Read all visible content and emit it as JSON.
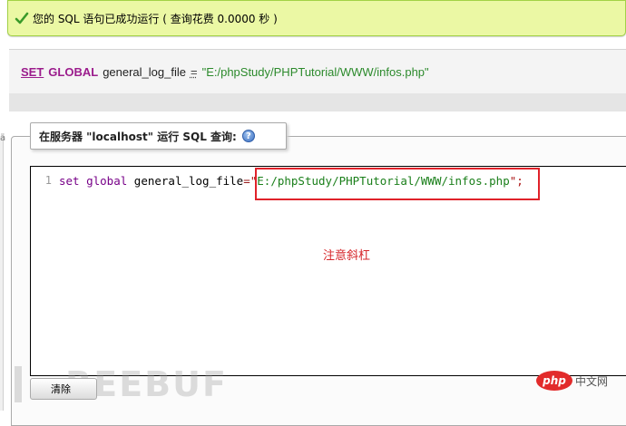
{
  "success": {
    "message": "您的 SQL 语句已成功运行 ( 查询花费 0.0000 秒 )",
    "icon": "check-icon"
  },
  "sql_display": {
    "kw1": "SET",
    "kw2": "GLOBAL",
    "variable": "general_log_file",
    "operator": "=",
    "value": "\"E:/phpStudy/PHPTutorial/WWW/infos.php\""
  },
  "query_panel": {
    "legend": "在服务器 \"localhost\" 运行 SQL 查询:",
    "help_icon": "help-icon",
    "left_edge_char": "ä"
  },
  "editor": {
    "line_number": "1",
    "tokens": {
      "set": "set",
      "global": "global",
      "var": "general_log_file",
      "eq": "=",
      "quote": "\"",
      "path": "E:/phpStudy/PHPTutorial/WWW/infos.php",
      "end": "\";"
    }
  },
  "annotation": "注意斜杠",
  "buttons": {
    "clear": "清除"
  },
  "watermark": "REEBUF",
  "site_badge": {
    "logo": "php",
    "text": "中文网"
  },
  "colors": {
    "success_bg": "#ebf8a4",
    "highlight": "#e0222a",
    "keyword": "#9b1c8c"
  }
}
